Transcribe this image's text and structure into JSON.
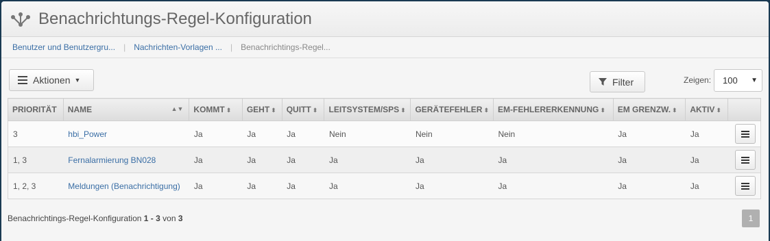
{
  "header": {
    "title": "Benachrichtungs-Regel-Konfiguration"
  },
  "breadcrumb": {
    "items": [
      "Benutzer und Benutzergru...",
      "Nachrichten-Vorlagen ...",
      "Benachrichtings-Regel..."
    ]
  },
  "toolbar": {
    "actions_label": "Aktionen",
    "filter_label": "Filter",
    "show_label": "Zeigen:",
    "page_size": "100"
  },
  "table": {
    "columns": [
      "PRIORITÄT",
      "NAME",
      "KOMMT",
      "GEHT",
      "QUITT",
      "LEITSYSTEM/SPS",
      "GERÄTEFEHLER",
      "EM-FEHLERERKENNUNG",
      "EM GRENZW.",
      "AKTIV"
    ],
    "rows": [
      [
        "3",
        "hbi_Power",
        "Ja",
        "Ja",
        "Ja",
        "Nein",
        "Nein",
        "Nein",
        "Ja",
        "Ja"
      ],
      [
        "1, 3",
        "Fernalarmierung BN028",
        "Ja",
        "Ja",
        "Ja",
        "Ja",
        "Ja",
        "Ja",
        "Ja",
        "Ja"
      ],
      [
        "1, 2, 3",
        "Meldungen (Benachrichtigung)",
        "Ja",
        "Ja",
        "Ja",
        "Ja",
        "Ja",
        "Ja",
        "Ja",
        "Ja"
      ]
    ]
  },
  "footer": {
    "summary_prefix": "Benachrichtings-Regel-Konfiguration",
    "range": "1 - 3",
    "of_word": "von",
    "total": "3",
    "page": "1"
  }
}
